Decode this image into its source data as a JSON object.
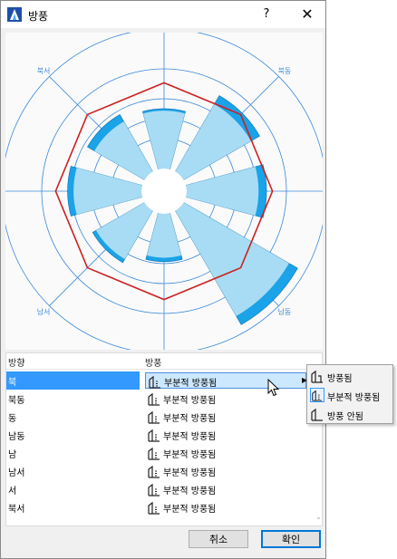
{
  "window": {
    "title": "방풍",
    "help_label": "?",
    "close_label": "✕",
    "icon": "wind-rose-app-icon"
  },
  "chart_data": {
    "type": "polar-bar",
    "directions": [
      "북",
      "북동",
      "동",
      "남동",
      "남",
      "남서",
      "서",
      "북서"
    ],
    "outer_values": [
      3.0,
      4.4,
      4.0,
      6.6,
      2.4,
      3.0,
      3.7,
      3.3
    ],
    "inner_values": [
      2.9,
      3.9,
      3.6,
      6.1,
      2.2,
      2.8,
      3.4,
      2.9
    ],
    "polygon_values": [
      4.3,
      4.3,
      4.3,
      4.3,
      4.3,
      4.3,
      4.3,
      4.3
    ],
    "rings": [
      1.5,
      2.5,
      3.5,
      5,
      7
    ],
    "colors": {
      "sector_light": "#a8dcf4",
      "sector_dark": "#1aa3e8",
      "polygon": "#cc2020",
      "rings": "#3c8ad9",
      "grid_bg": "#fafafa"
    }
  },
  "table": {
    "headers": {
      "direction": "방향",
      "shielding": "방풍"
    },
    "rows": [
      {
        "direction": "북",
        "value": "부분적 방풍됨",
        "icon": "partially-shielded-icon"
      },
      {
        "direction": "북동",
        "value": "부분적 방풍됨",
        "icon": "partially-shielded-icon"
      },
      {
        "direction": "동",
        "value": "부분적 방풍됨",
        "icon": "partially-shielded-icon"
      },
      {
        "direction": "남동",
        "value": "부분적 방풍됨",
        "icon": "partially-shielded-icon"
      },
      {
        "direction": "남",
        "value": "부분적 방풍됨",
        "icon": "partially-shielded-icon"
      },
      {
        "direction": "남서",
        "value": "부분적 방풍됨",
        "icon": "partially-shielded-icon"
      },
      {
        "direction": "서",
        "value": "부분적 방풍됨",
        "icon": "partially-shielded-icon"
      },
      {
        "direction": "북서",
        "value": "부분적 방풍됨",
        "icon": "partially-shielded-icon"
      }
    ],
    "selected_row": "북"
  },
  "popup_menu": {
    "options": [
      {
        "label": "방풍됨",
        "icon": "shielded-icon"
      },
      {
        "label": "부분적 방풍됨",
        "icon": "partially-shielded-icon"
      },
      {
        "label": "방풍 안됨",
        "icon": "not-shielded-icon"
      }
    ],
    "current": "부분적 방풍됨"
  },
  "buttons": {
    "cancel": "취소",
    "ok": "확인"
  }
}
